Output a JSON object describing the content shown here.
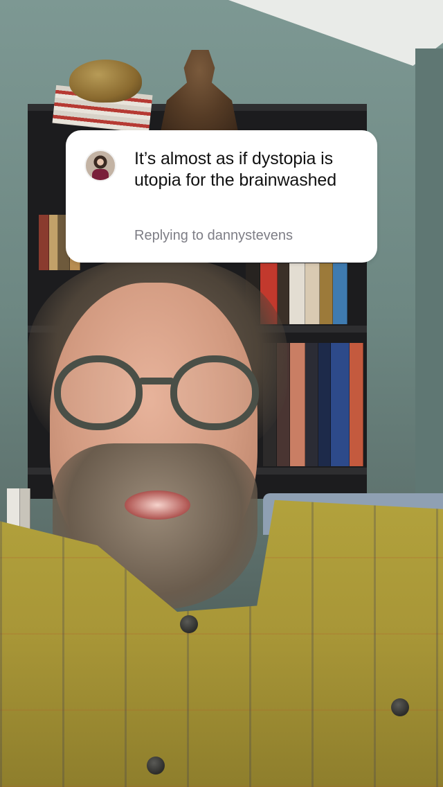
{
  "reply_sticker": {
    "comment": "It’s almost as if dystopia is utopia for the brainwashed",
    "replying_to": "Replying to dannystevens",
    "avatar_icon": "profile-avatar"
  },
  "colors": {
    "card_background": "#ffffff",
    "comment_text": "#111111",
    "secondary_text": "#7d7d85",
    "shirt": "#b3a33d",
    "wall": "#6f8985"
  }
}
